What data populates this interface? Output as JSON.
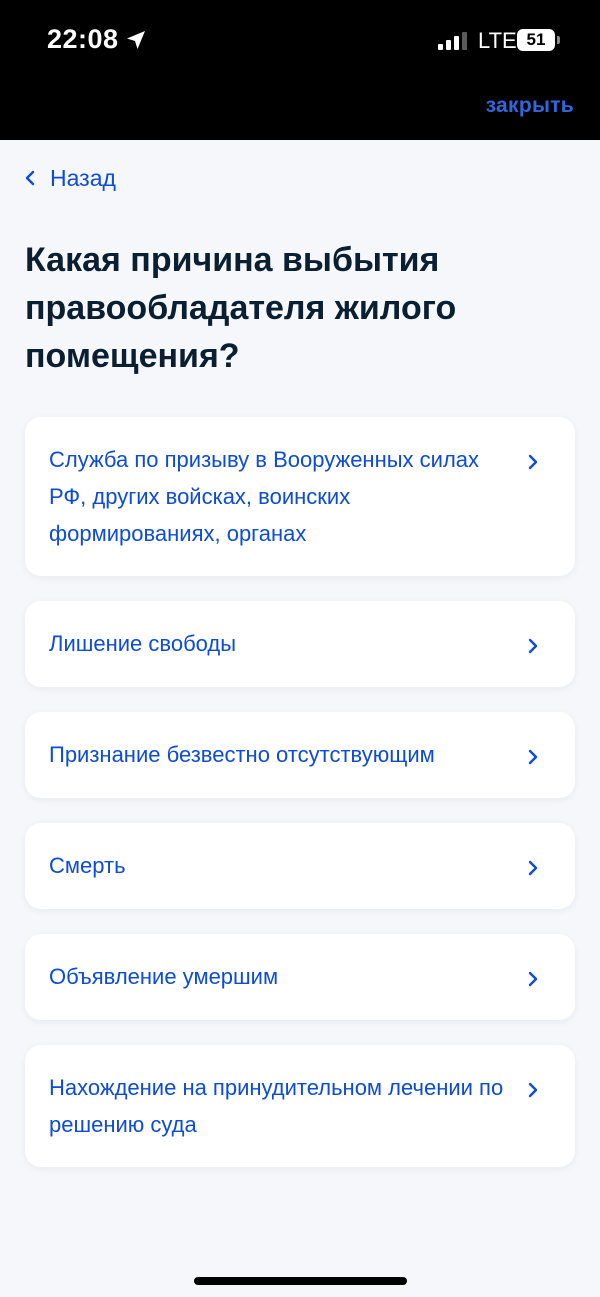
{
  "status_bar": {
    "time": "22:08",
    "network": "LTE",
    "battery": "51",
    "icons": [
      "location-arrow-icon",
      "signal-icon",
      "battery-icon"
    ]
  },
  "header": {
    "close_label": "закрыть"
  },
  "nav": {
    "back_label": "Назад"
  },
  "main": {
    "title": "Какая причина выбытия правообладателя жилого помещения?",
    "options": [
      {
        "label": "Служба по призыву в Вооруженных силах РФ, других войсках, воинских формированиях, органах"
      },
      {
        "label": "Лишение свободы"
      },
      {
        "label": "Признание безвестно отсутствующим"
      },
      {
        "label": "Смерть"
      },
      {
        "label": "Объявление умершим"
      },
      {
        "label": "Нахождение на принудительном лечении по решению суда"
      }
    ]
  },
  "colors": {
    "accent": "#0d4cd3",
    "close_link": "#3366dd",
    "title": "#0b1f33",
    "background": "#f5f7fb",
    "card": "#ffffff"
  }
}
